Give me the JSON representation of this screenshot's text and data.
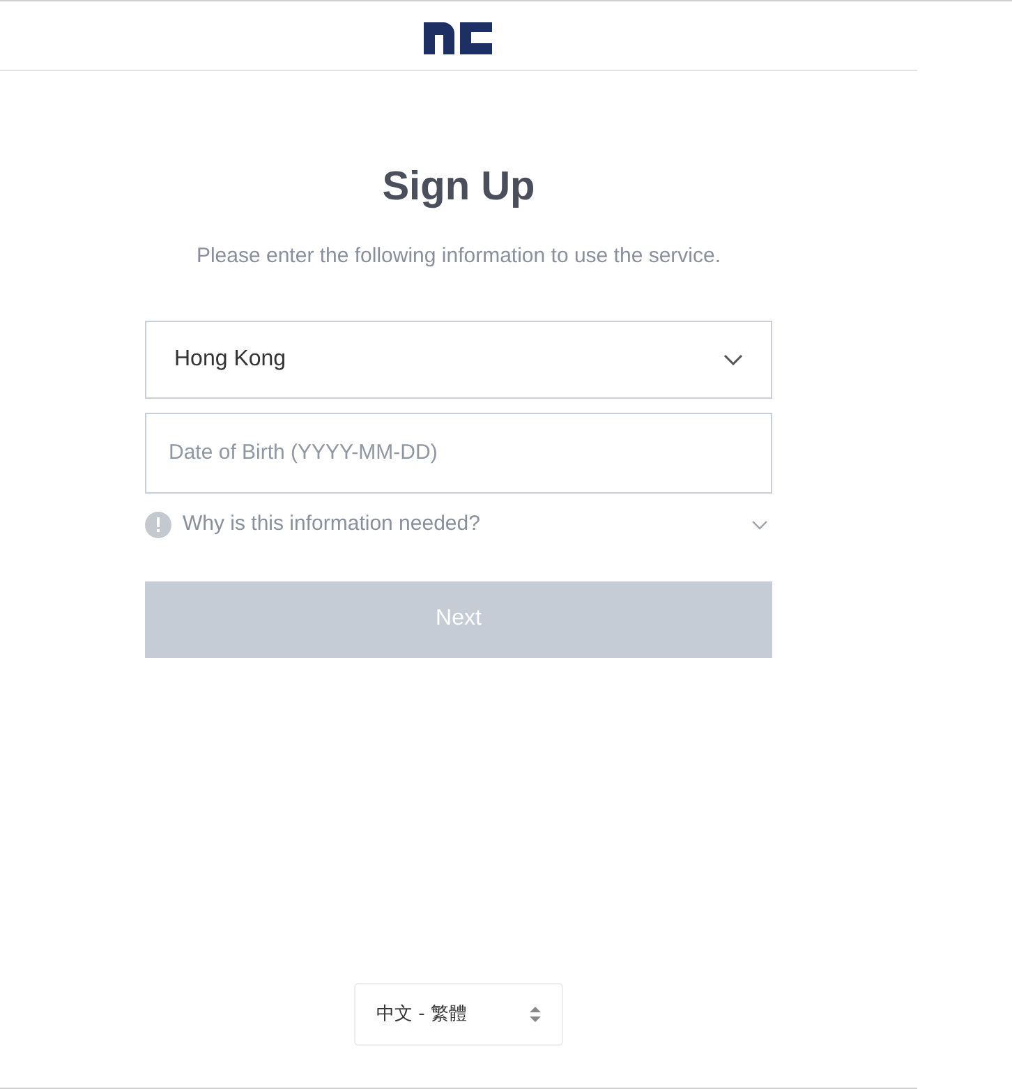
{
  "title": "Sign Up",
  "subtitle": "Please enter the following information to use the service.",
  "country_select": {
    "value": "Hong Kong"
  },
  "birth_date": {
    "placeholder": "Date of Birth (YYYY-MM-DD)"
  },
  "info_toggle": {
    "label": "Why is this information needed?",
    "expanded": false
  },
  "next_button": {
    "label": "Next",
    "disabled": true
  },
  "language_select": {
    "value": "中文 - 繁體"
  }
}
